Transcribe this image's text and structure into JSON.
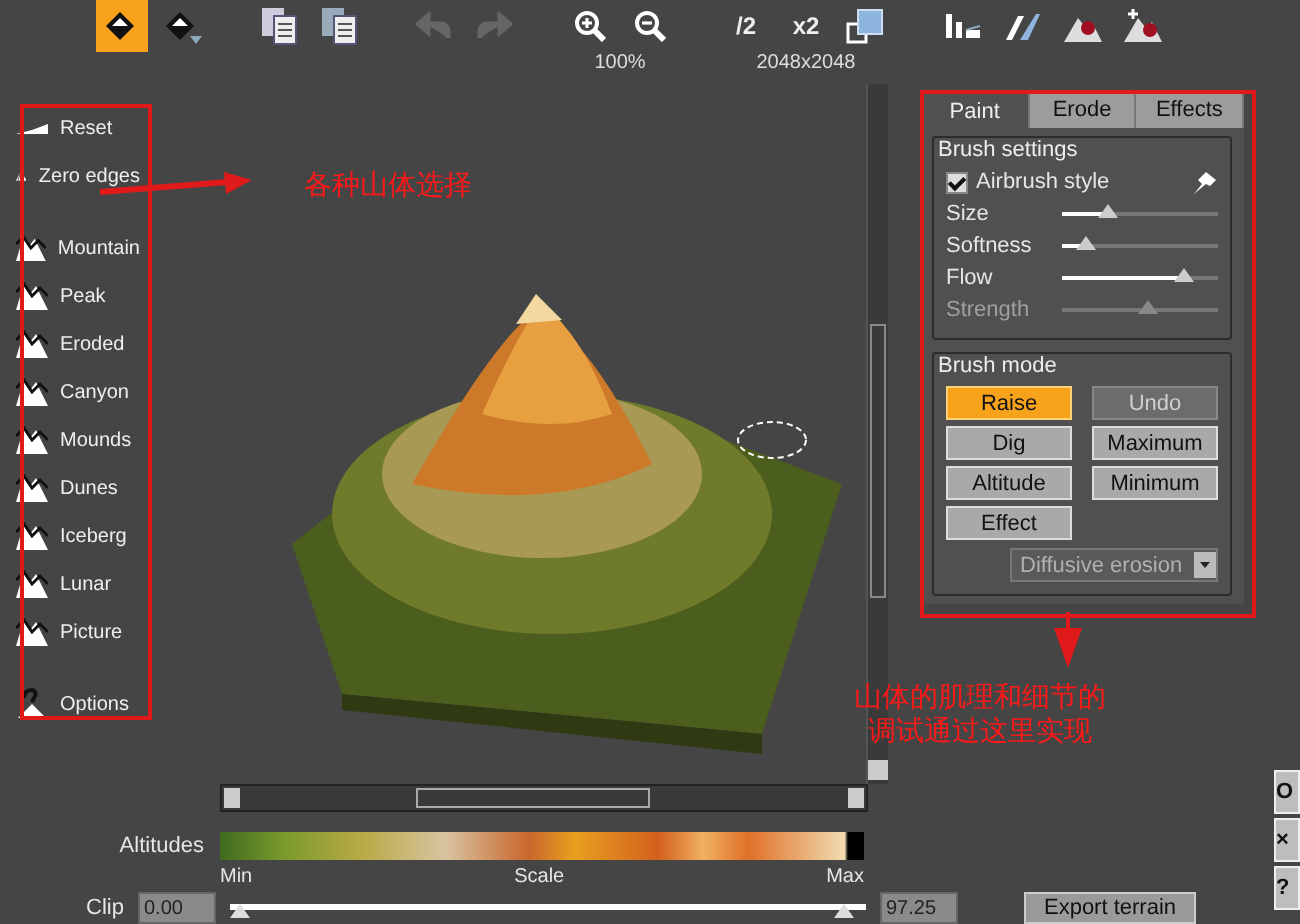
{
  "toolbar": {
    "mode_buttons": [
      {
        "selected": true
      },
      {
        "selected": false
      }
    ],
    "half_label": "/2",
    "double_label": "x2",
    "zoom_reading": "100%",
    "resolution_reading": "2048x2048"
  },
  "terrain_tools": [
    {
      "label": "Reset"
    },
    {
      "label": "Zero edges"
    }
  ],
  "terrain_presets": [
    {
      "label": "Mountain"
    },
    {
      "label": "Peak"
    },
    {
      "label": "Eroded"
    },
    {
      "label": "Canyon"
    },
    {
      "label": "Mounds"
    },
    {
      "label": "Dunes"
    },
    {
      "label": "Iceberg"
    },
    {
      "label": "Lunar"
    },
    {
      "label": "Picture"
    }
  ],
  "options_item": {
    "label": "Options"
  },
  "tabs": [
    {
      "label": "Paint",
      "selected": true
    },
    {
      "label": "Erode",
      "selected": false
    },
    {
      "label": "Effects",
      "selected": false
    }
  ],
  "brush_settings": {
    "title": "Brush settings",
    "airbrush": {
      "label": "Airbrush style",
      "checked": true
    },
    "sliders": [
      {
        "label": "Size",
        "level": 0.3,
        "disabled": false
      },
      {
        "label": "Softness",
        "level": 0.15,
        "disabled": false
      },
      {
        "label": "Flow",
        "level": 0.78,
        "disabled": false
      },
      {
        "label": "Strength",
        "level": 0.55,
        "disabled": true
      }
    ]
  },
  "brush_mode": {
    "title": "Brush mode",
    "buttons": [
      {
        "label": "Raise",
        "selected": true,
        "disabled": false
      },
      {
        "label": "Undo",
        "selected": false,
        "disabled": true
      },
      {
        "label": "Dig",
        "selected": false,
        "disabled": false
      },
      {
        "label": "Maximum",
        "selected": false,
        "disabled": false
      },
      {
        "label": "Altitude",
        "selected": false,
        "disabled": false
      },
      {
        "label": "Minimum",
        "selected": false,
        "disabled": false
      },
      {
        "label": "Effect",
        "selected": false,
        "disabled": false
      }
    ],
    "effect_select": {
      "value": "Diffusive erosion",
      "disabled": true
    }
  },
  "altitudes": {
    "label": "Altitudes",
    "min": "Min",
    "scale": "Scale",
    "max": "Max"
  },
  "clip": {
    "label": "Clip",
    "low": "0.00",
    "high": "97.25"
  },
  "export_button": "Export terrain",
  "side_buttons": [
    "O",
    "×",
    "?"
  ],
  "annotations": [
    {
      "text": "各种山体选择"
    },
    {
      "text": "山体的肌理和细节的调试通过这里实现"
    }
  ]
}
